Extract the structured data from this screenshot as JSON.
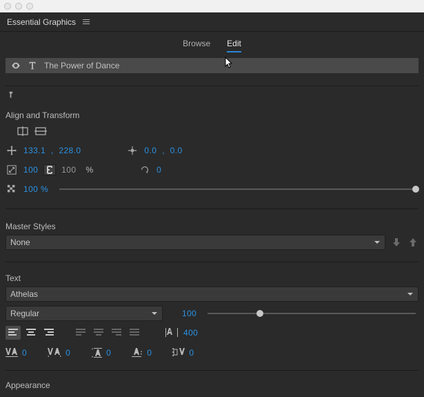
{
  "panel": {
    "title": "Essential Graphics"
  },
  "tabs": {
    "browse": "Browse",
    "edit": "Edit"
  },
  "layer": {
    "title": "The Power of Dance"
  },
  "sections": {
    "alignTransform": "Align and Transform",
    "masterStyles": "Master Styles",
    "text": "Text",
    "appearance": "Appearance"
  },
  "transform": {
    "posX": "133.1",
    "posSep": " , ",
    "posY": "228.0",
    "anchorX": "0.0",
    "anchorSep": " , ",
    "anchorY": "0.0",
    "scaleX": "100",
    "scaleY": "100",
    "scaleUnit": "%",
    "rotation": "0",
    "opacity": "100 %"
  },
  "masterStyles": {
    "selected": "None"
  },
  "text": {
    "font": "Athelas",
    "weight": "Regular",
    "size": "100",
    "tracking": "400",
    "kerningVA": "0",
    "kerningVA2": "0",
    "leading": "0",
    "baseline": "0",
    "tsume": "0"
  }
}
